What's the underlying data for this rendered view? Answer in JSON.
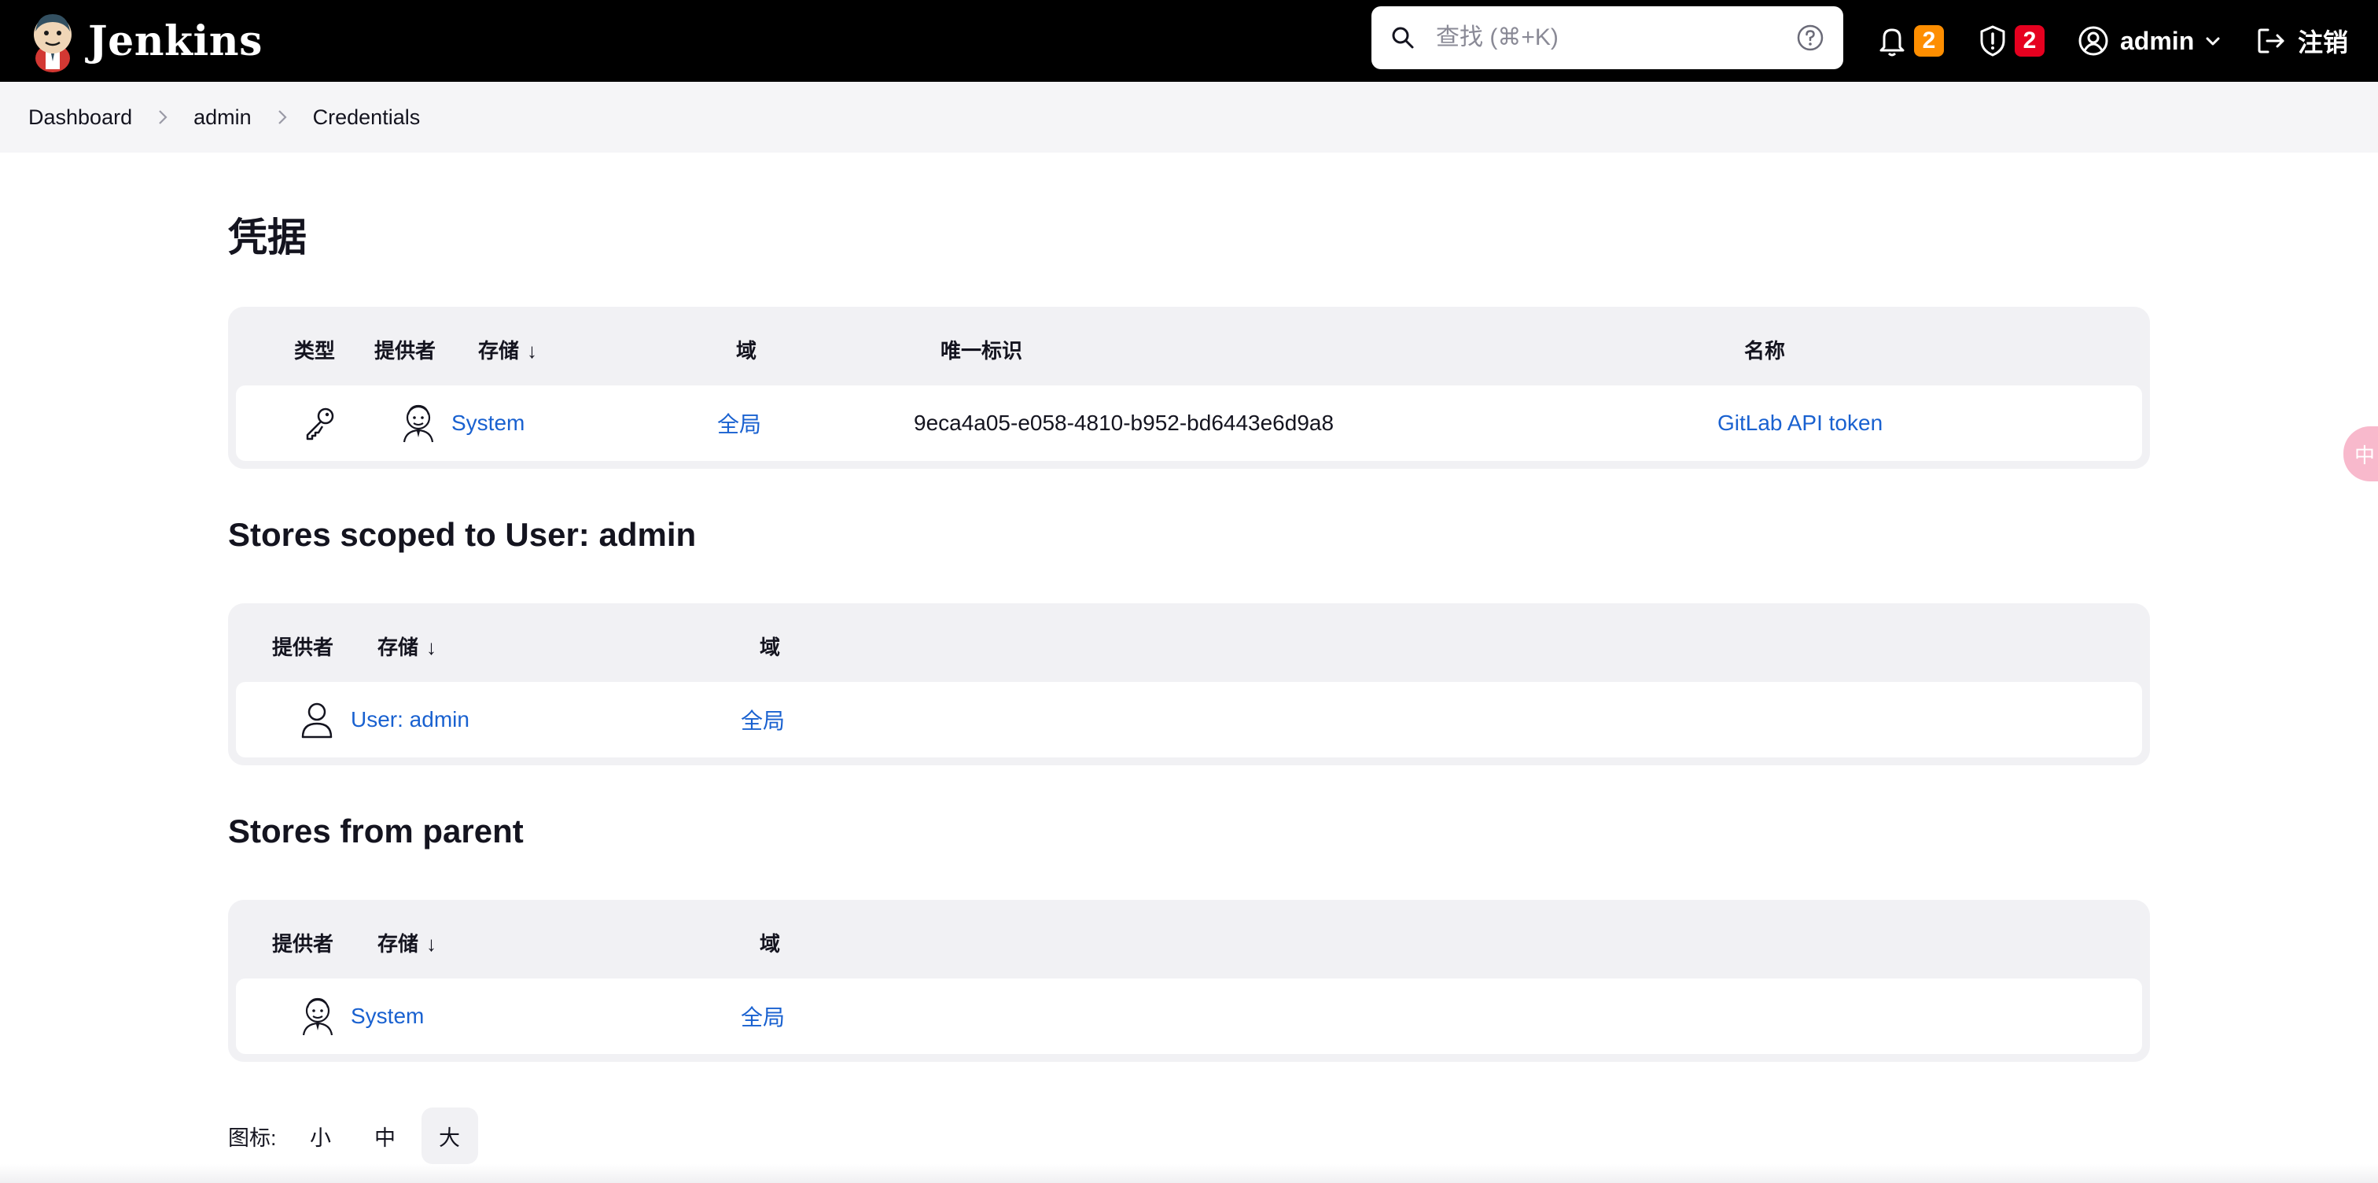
{
  "header": {
    "app_name": "Jenkins",
    "search_placeholder": "查找 (⌘+K)",
    "notifications_count": "2",
    "security_count": "2",
    "user": "admin",
    "logout_label": "注销",
    "colors": {
      "bar": "#000000",
      "notification_badge": "#fe8e00",
      "security_badge": "#e6001f"
    }
  },
  "breadcrumb": [
    "Dashboard",
    "admin",
    "Credentials"
  ],
  "page_title": "凭据",
  "credentials_table": {
    "headers": {
      "type": "类型",
      "provider": "提供者",
      "store": "存储",
      "domain": "域",
      "id": "唯一标识",
      "name": "名称"
    },
    "rows": [
      {
        "type_icon": "key-icon",
        "provider_icon": "jenkins-butler-icon",
        "store": "System",
        "domain": "全局",
        "id": "9eca4a05-e058-4810-b952-bd6443e6d9a8",
        "name": "GitLab API token"
      }
    ]
  },
  "user_scoped": {
    "title": "Stores scoped to User: admin",
    "headers": {
      "provider": "提供者",
      "store": "存储",
      "domain": "域"
    },
    "rows": [
      {
        "provider_icon": "user-icon",
        "store": "User: admin",
        "domain": "全局"
      }
    ]
  },
  "parent_stores": {
    "title": "Stores from parent",
    "headers": {
      "provider": "提供者",
      "store": "存储",
      "domain": "域"
    },
    "rows": [
      {
        "provider_icon": "jenkins-butler-icon",
        "store": "System",
        "domain": "全局"
      }
    ]
  },
  "icon_size": {
    "label": "图标:",
    "options": [
      "小",
      "中",
      "大"
    ],
    "selected": "大"
  },
  "side_tab_label": "中",
  "link_color": "#1961d0"
}
